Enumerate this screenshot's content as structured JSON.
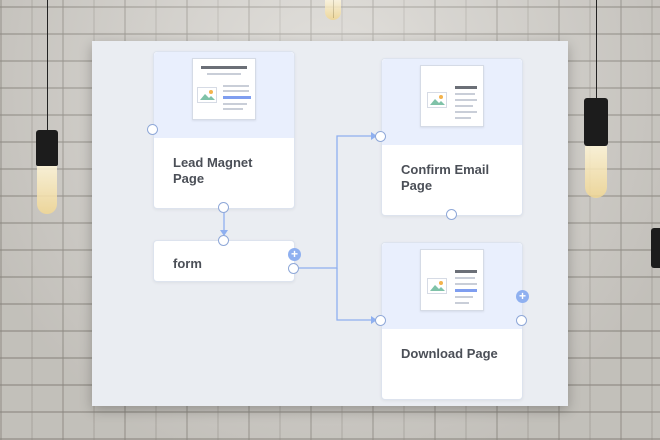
{
  "cards": {
    "lead_magnet": {
      "title_line1": "Lead Magnet",
      "title_line2": "Page"
    },
    "form": {
      "title": "form"
    },
    "confirm_email": {
      "title_line1": "Confirm Email",
      "title_line2": "Page"
    },
    "download": {
      "title": "Download Page"
    }
  },
  "icons": {
    "add": "+",
    "image": "image-placeholder-icon",
    "port": "connector-port-icon"
  },
  "colors": {
    "canvas": "#eaedf2",
    "thumb_zone": "#e9effd",
    "connector": "#8fb0f0",
    "accent": "#7f9ef0"
  }
}
